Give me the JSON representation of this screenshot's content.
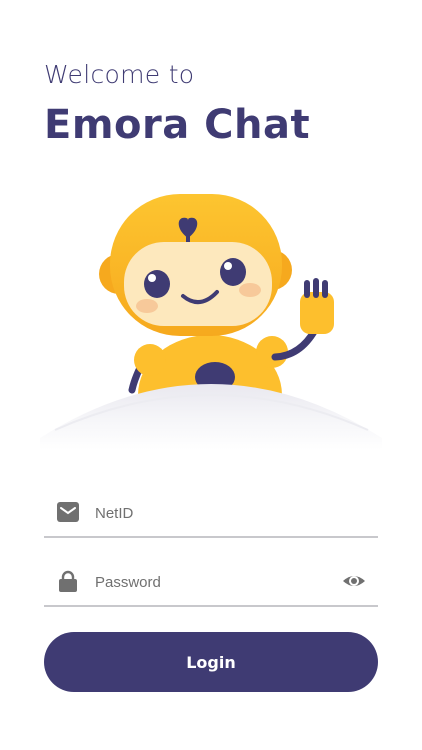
{
  "header": {
    "welcome_text": "Welcome to",
    "app_name": "Emora Chat"
  },
  "form": {
    "netid_placeholder": "NetID",
    "netid_value": "",
    "password_placeholder": "Password",
    "password_value": "",
    "login_label": "Login"
  },
  "icons": {
    "mascot": "robot-mascot-waving",
    "netid": "mail-icon",
    "password": "lock-icon",
    "toggle": "eye-icon"
  },
  "colors": {
    "primary": "#3f3b73",
    "robot_body": "#fdbf2d",
    "icon_gray": "#707070",
    "underline": "#c8c8cc"
  }
}
